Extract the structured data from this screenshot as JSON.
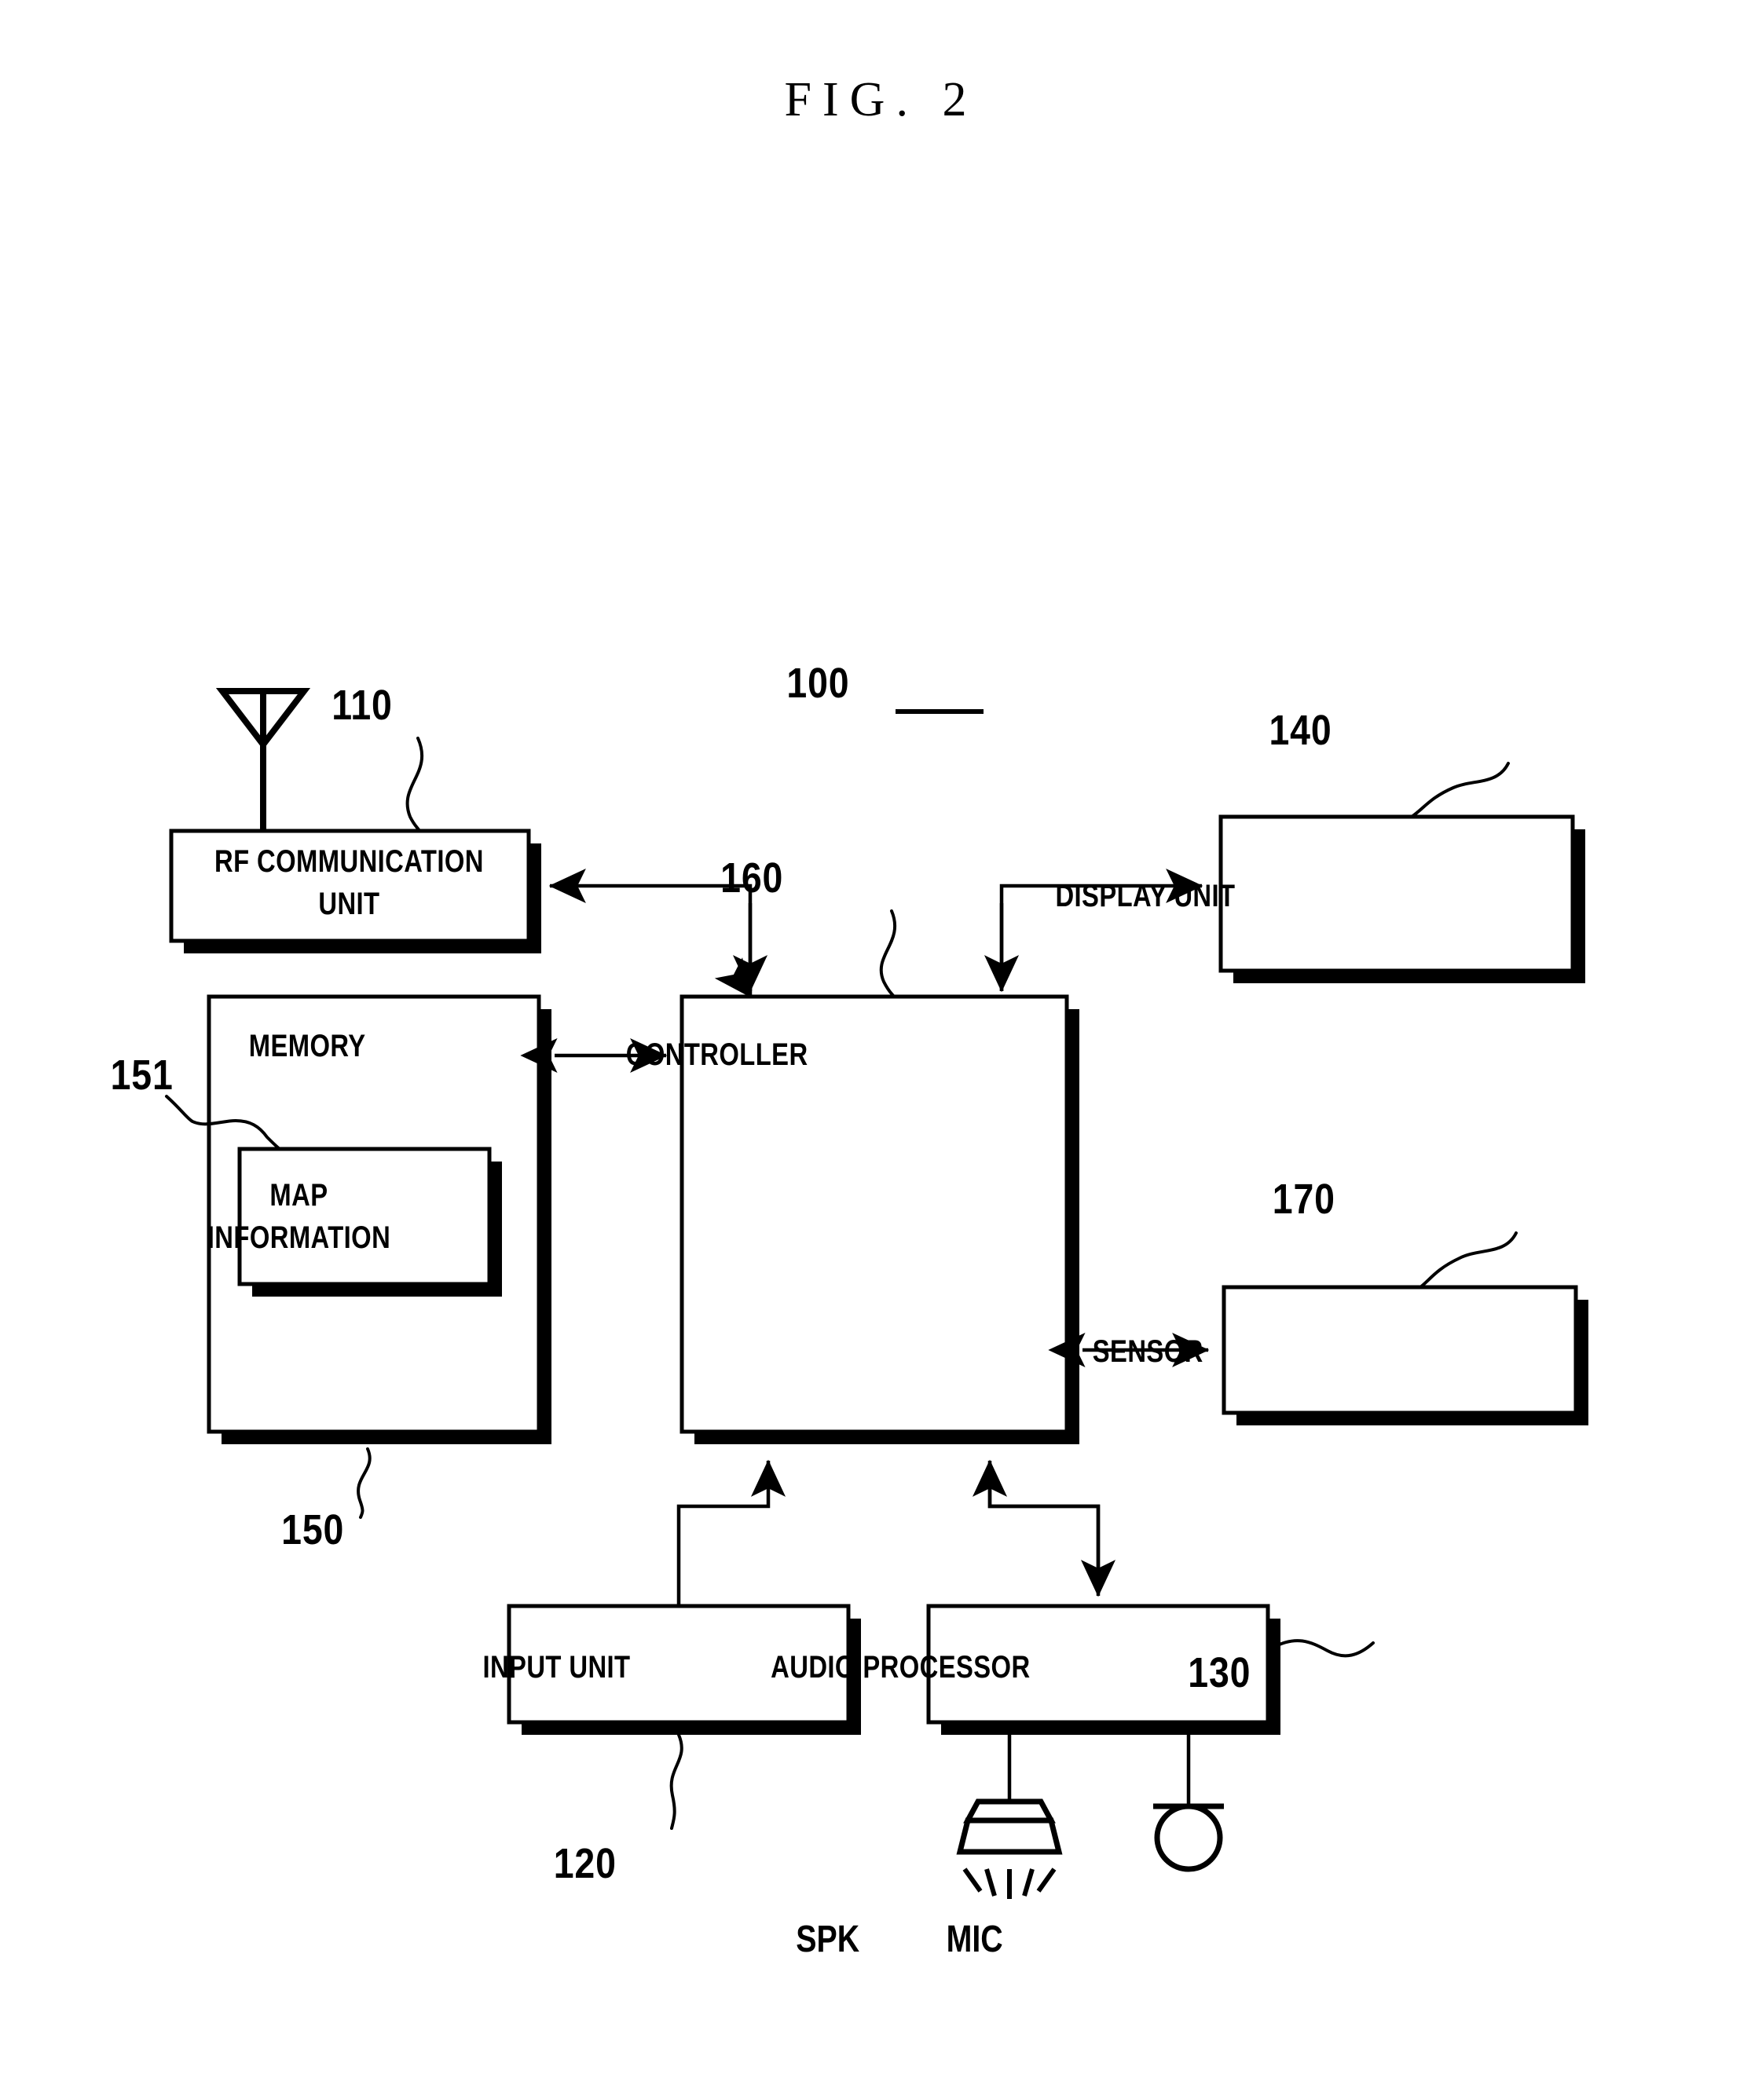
{
  "figure": {
    "title": "FIG. 2",
    "device_reference": "100"
  },
  "blocks": [
    {
      "id": "rf",
      "label_line1": "RF COMMUNICATION",
      "label_line2": "UNIT",
      "ref": "110"
    },
    {
      "id": "memory",
      "label": "MEMORY",
      "ref": "150"
    },
    {
      "id": "map_information",
      "label_line1": "MAP",
      "label_line2": "INFORMATION",
      "ref": "151"
    },
    {
      "id": "controller",
      "label": "CONTROLLER",
      "ref": "160"
    },
    {
      "id": "display",
      "label": "DISPLAY UNIT",
      "ref": "140"
    },
    {
      "id": "sensor",
      "label": "SENSOR",
      "ref": "170"
    },
    {
      "id": "input",
      "label": "INPUT UNIT",
      "ref": "120"
    },
    {
      "id": "audio",
      "label": "AUDIO PROCESSOR",
      "ref": "130"
    }
  ],
  "peripherals": [
    {
      "id": "speaker",
      "label": "SPK",
      "icon": "speaker-icon"
    },
    {
      "id": "microphone",
      "label": "MIC",
      "icon": "microphone-icon"
    }
  ],
  "icons": {
    "antenna": "antenna-icon"
  },
  "colors": {
    "ink": "#000000",
    "paper": "#ffffff"
  }
}
